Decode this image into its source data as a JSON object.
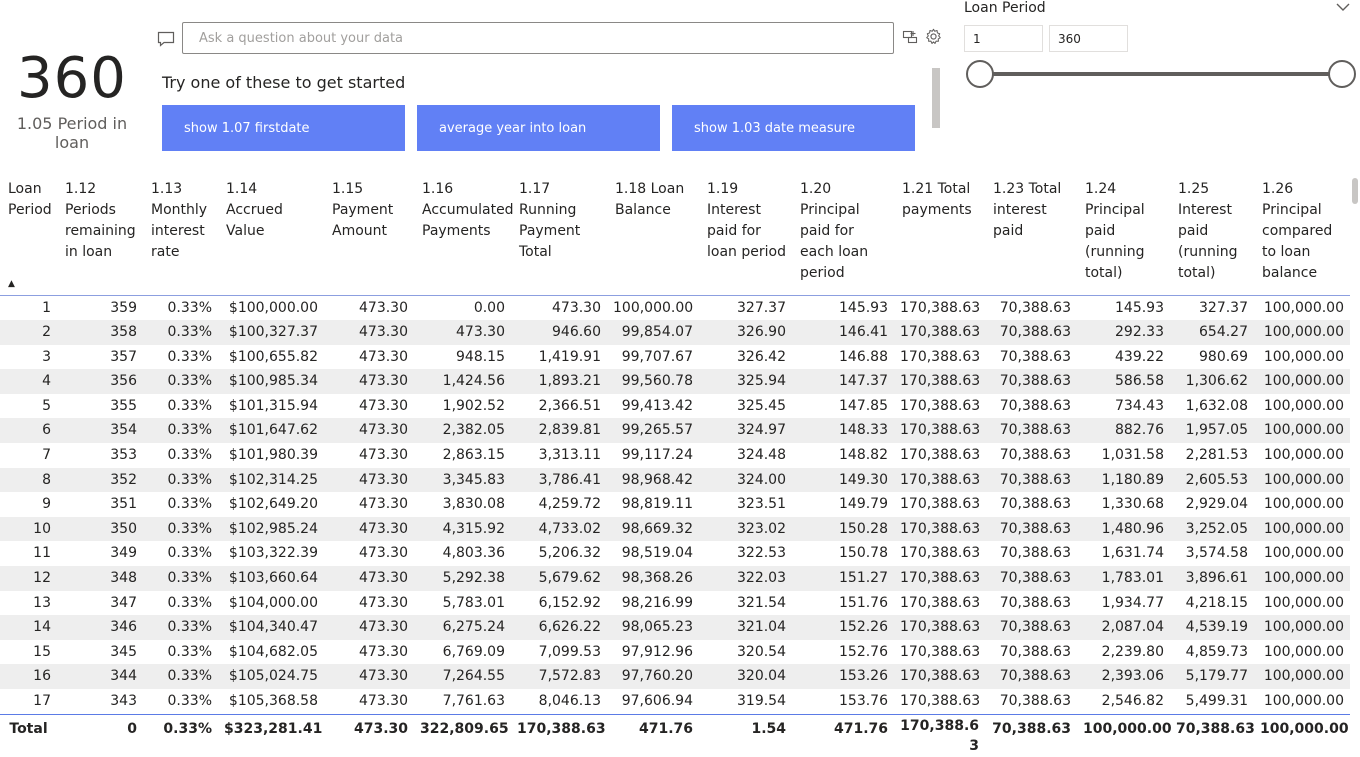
{
  "kpi": {
    "value": "360",
    "label": "1.05 Period in loan"
  },
  "qa": {
    "placeholder": "Ask a question about your data",
    "hint": "Try one of these to get started",
    "suggestions": [
      "show 1.07 firstdate",
      "average year into loan",
      "show 1.03 date measure"
    ]
  },
  "slicer": {
    "title": "Loan Period",
    "min": "1",
    "max": "360",
    "range_fraction": [
      0.0,
      1.0
    ]
  },
  "table": {
    "headers": [
      "Loan Period",
      "1.12 Periods remaining in loan",
      "1.13 Monthly interest rate",
      "1.14 Accrued Value",
      "1.15 Payment Amount",
      "1.16 Accumulated Payments",
      "1.17 Running Payment Total",
      "1.18 Loan Balance",
      "1.19 Interest paid for loan period",
      "1.20 Principal paid for each loan period",
      "1.21 Total payments",
      "1.23 Total interest paid",
      "1.24 Principal paid (running total)",
      "1.25 Interest paid (running total)",
      "1.26 Principal compared to loan balance"
    ],
    "rows": [
      [
        "1",
        "359",
        "0.33%",
        "$100,000.00",
        "473.30",
        "0.00",
        "473.30",
        "100,000.00",
        "327.37",
        "145.93",
        "170,388.63",
        "70,388.63",
        "145.93",
        "327.37",
        "100,000.00"
      ],
      [
        "2",
        "358",
        "0.33%",
        "$100,327.37",
        "473.30",
        "473.30",
        "946.60",
        "99,854.07",
        "326.90",
        "146.41",
        "170,388.63",
        "70,388.63",
        "292.33",
        "654.27",
        "100,000.00"
      ],
      [
        "3",
        "357",
        "0.33%",
        "$100,655.82",
        "473.30",
        "948.15",
        "1,419.91",
        "99,707.67",
        "326.42",
        "146.88",
        "170,388.63",
        "70,388.63",
        "439.22",
        "980.69",
        "100,000.00"
      ],
      [
        "4",
        "356",
        "0.33%",
        "$100,985.34",
        "473.30",
        "1,424.56",
        "1,893.21",
        "99,560.78",
        "325.94",
        "147.37",
        "170,388.63",
        "70,388.63",
        "586.58",
        "1,306.62",
        "100,000.00"
      ],
      [
        "5",
        "355",
        "0.33%",
        "$101,315.94",
        "473.30",
        "1,902.52",
        "2,366.51",
        "99,413.42",
        "325.45",
        "147.85",
        "170,388.63",
        "70,388.63",
        "734.43",
        "1,632.08",
        "100,000.00"
      ],
      [
        "6",
        "354",
        "0.33%",
        "$101,647.62",
        "473.30",
        "2,382.05",
        "2,839.81",
        "99,265.57",
        "324.97",
        "148.33",
        "170,388.63",
        "70,388.63",
        "882.76",
        "1,957.05",
        "100,000.00"
      ],
      [
        "7",
        "353",
        "0.33%",
        "$101,980.39",
        "473.30",
        "2,863.15",
        "3,313.11",
        "99,117.24",
        "324.48",
        "148.82",
        "170,388.63",
        "70,388.63",
        "1,031.58",
        "2,281.53",
        "100,000.00"
      ],
      [
        "8",
        "352",
        "0.33%",
        "$102,314.25",
        "473.30",
        "3,345.83",
        "3,786.41",
        "98,968.42",
        "324.00",
        "149.30",
        "170,388.63",
        "70,388.63",
        "1,180.89",
        "2,605.53",
        "100,000.00"
      ],
      [
        "9",
        "351",
        "0.33%",
        "$102,649.20",
        "473.30",
        "3,830.08",
        "4,259.72",
        "98,819.11",
        "323.51",
        "149.79",
        "170,388.63",
        "70,388.63",
        "1,330.68",
        "2,929.04",
        "100,000.00"
      ],
      [
        "10",
        "350",
        "0.33%",
        "$102,985.24",
        "473.30",
        "4,315.92",
        "4,733.02",
        "98,669.32",
        "323.02",
        "150.28",
        "170,388.63",
        "70,388.63",
        "1,480.96",
        "3,252.05",
        "100,000.00"
      ],
      [
        "11",
        "349",
        "0.33%",
        "$103,322.39",
        "473.30",
        "4,803.36",
        "5,206.32",
        "98,519.04",
        "322.53",
        "150.78",
        "170,388.63",
        "70,388.63",
        "1,631.74",
        "3,574.58",
        "100,000.00"
      ],
      [
        "12",
        "348",
        "0.33%",
        "$103,660.64",
        "473.30",
        "5,292.38",
        "5,679.62",
        "98,368.26",
        "322.03",
        "151.27",
        "170,388.63",
        "70,388.63",
        "1,783.01",
        "3,896.61",
        "100,000.00"
      ],
      [
        "13",
        "347",
        "0.33%",
        "$104,000.00",
        "473.30",
        "5,783.01",
        "6,152.92",
        "98,216.99",
        "321.54",
        "151.76",
        "170,388.63",
        "70,388.63",
        "1,934.77",
        "4,218.15",
        "100,000.00"
      ],
      [
        "14",
        "346",
        "0.33%",
        "$104,340.47",
        "473.30",
        "6,275.24",
        "6,626.22",
        "98,065.23",
        "321.04",
        "152.26",
        "170,388.63",
        "70,388.63",
        "2,087.04",
        "4,539.19",
        "100,000.00"
      ],
      [
        "15",
        "345",
        "0.33%",
        "$104,682.05",
        "473.30",
        "6,769.09",
        "7,099.53",
        "97,912.96",
        "320.54",
        "152.76",
        "170,388.63",
        "70,388.63",
        "2,239.80",
        "4,859.73",
        "100,000.00"
      ],
      [
        "16",
        "344",
        "0.33%",
        "$105,024.75",
        "473.30",
        "7,264.55",
        "7,572.83",
        "97,760.20",
        "320.04",
        "153.26",
        "170,388.63",
        "70,388.63",
        "2,393.06",
        "5,179.77",
        "100,000.00"
      ],
      [
        "17",
        "343",
        "0.33%",
        "$105,368.58",
        "473.30",
        "7,761.63",
        "8,046.13",
        "97,606.94",
        "319.54",
        "153.76",
        "170,388.63",
        "70,388.63",
        "2,546.82",
        "5,499.31",
        "100,000.00"
      ]
    ],
    "totals": [
      "Total",
      "0",
      "0.33%",
      "$323,281.41",
      "473.30",
      "322,809.65",
      "170,388.63",
      "471.76",
      "1.54",
      "471.76",
      "170,388.63",
      "70,388.63",
      "100,000.00",
      "70,388.63",
      "100,000.00"
    ]
  },
  "icons": {
    "qa": "speech-bubble-icon",
    "tool1": "ask-a-related-question-icon",
    "tool2": "gear-icon",
    "chevron": "chevron-down-icon",
    "sort": "sort-ascending-icon"
  },
  "colors": {
    "accent": "#6180f5",
    "row_alt": "#eeeeee",
    "header_rule": "#8c9fe0"
  }
}
